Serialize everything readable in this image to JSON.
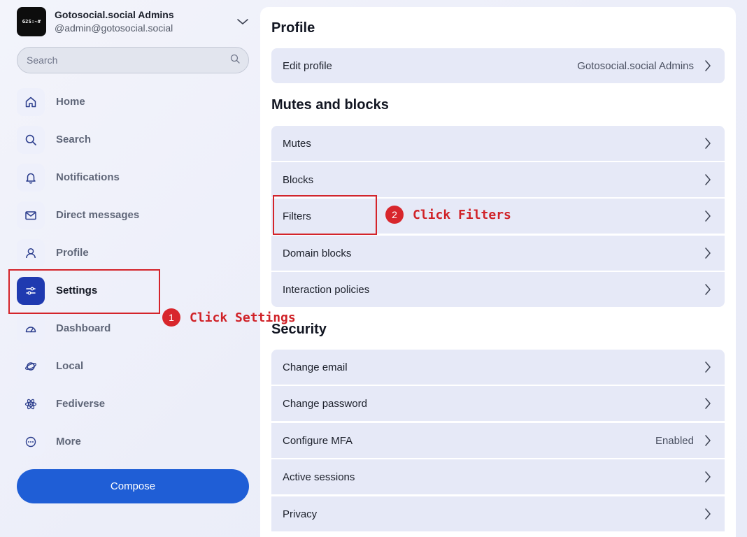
{
  "account": {
    "avatar_text": "G2S:~#",
    "name": "Gotosocial.social Admins",
    "handle": "@admin@gotosocial.social"
  },
  "search": {
    "placeholder": "Search"
  },
  "nav": {
    "items": [
      {
        "label": "Home",
        "icon": "home-icon"
      },
      {
        "label": "Search",
        "icon": "search-icon"
      },
      {
        "label": "Notifications",
        "icon": "bell-icon"
      },
      {
        "label": "Direct messages",
        "icon": "mail-icon"
      },
      {
        "label": "Profile",
        "icon": "user-icon"
      },
      {
        "label": "Settings",
        "icon": "sliders-icon",
        "active": true
      },
      {
        "label": "Dashboard",
        "icon": "gauge-icon"
      },
      {
        "label": "Local",
        "icon": "planet-icon"
      },
      {
        "label": "Fediverse",
        "icon": "atom-icon"
      },
      {
        "label": "More",
        "icon": "more-icon"
      }
    ]
  },
  "compose": {
    "label": "Compose"
  },
  "main": {
    "sections": [
      {
        "title": "Profile",
        "rows": [
          {
            "label": "Edit profile",
            "value": "Gotosocial.social Admins"
          }
        ]
      },
      {
        "title": "Mutes and blocks",
        "rows": [
          {
            "label": "Mutes"
          },
          {
            "label": "Blocks"
          },
          {
            "label": "Filters"
          },
          {
            "label": "Domain blocks"
          },
          {
            "label": "Interaction policies"
          }
        ]
      },
      {
        "title": "Security",
        "rows": [
          {
            "label": "Change email"
          },
          {
            "label": "Change password"
          },
          {
            "label": "Configure MFA",
            "value": "Enabled"
          },
          {
            "label": "Active sessions"
          },
          {
            "label": "Privacy"
          }
        ]
      }
    ]
  },
  "annotations": {
    "step1": {
      "number": "1",
      "text": "Click Settings"
    },
    "step2": {
      "number": "2",
      "text": "Click Filters"
    }
  },
  "colors": {
    "accent": "#1f5ed6",
    "active_nav": "#1f3ab0",
    "annotation": "#d4242a"
  }
}
